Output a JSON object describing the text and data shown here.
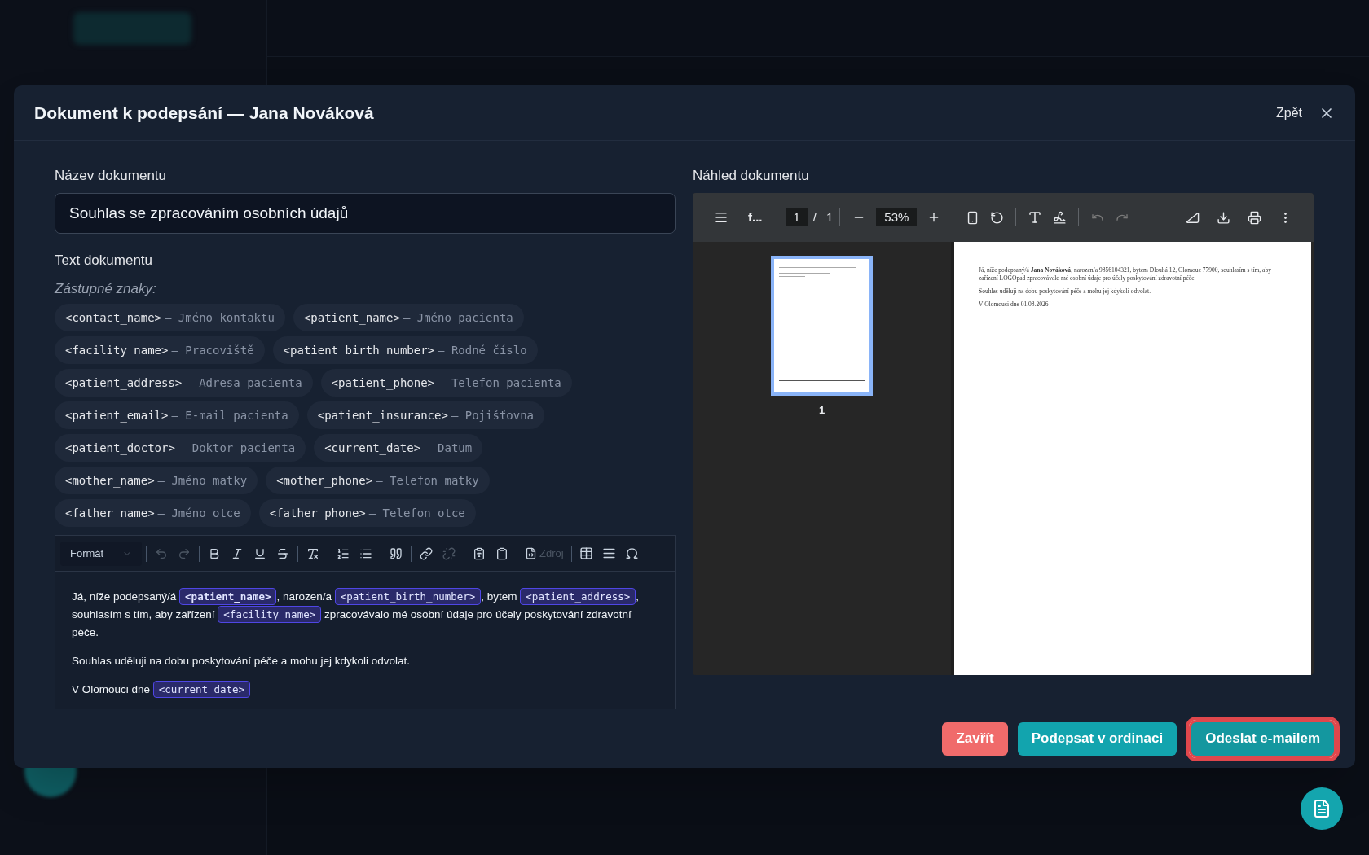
{
  "dialog": {
    "title": "Dokument k podepsání — Jana Nováková",
    "back_label": "Zpět"
  },
  "name_field": {
    "label": "Název dokumentu",
    "value": "Souhlas se zpracováním osobních údajů"
  },
  "text_section": {
    "label": "Text dokumentu",
    "placeholders_label": "Zástupné znaky:"
  },
  "placeholders": [
    {
      "code": "<contact_name>",
      "description": "— Jméno kontaktu"
    },
    {
      "code": "<patient_name>",
      "description": "— Jméno pacienta"
    },
    {
      "code": "<facility_name>",
      "description": "— Pracoviště"
    },
    {
      "code": "<patient_birth_number>",
      "description": "— Rodné číslo"
    },
    {
      "code": "<patient_address>",
      "description": "— Adresa pacienta"
    },
    {
      "code": "<patient_phone>",
      "description": "— Telefon pacienta"
    },
    {
      "code": "<patient_email>",
      "description": "— E-mail pacienta"
    },
    {
      "code": "<patient_insurance>",
      "description": "— Pojišťovna"
    },
    {
      "code": "<patient_doctor>",
      "description": "— Doktor pacienta"
    },
    {
      "code": "<current_date>",
      "description": "— Datum"
    },
    {
      "code": "<mother_name>",
      "description": "— Jméno matky"
    },
    {
      "code": "<mother_phone>",
      "description": "— Telefon matky"
    },
    {
      "code": "<father_name>",
      "description": "— Jméno otce"
    },
    {
      "code": "<father_phone>",
      "description": "— Telefon otce"
    }
  ],
  "editor": {
    "format_label": "Formát",
    "source_label": "Zdroj",
    "source_disabled": true,
    "paragraphs": [
      [
        {
          "kind": "text",
          "text": "Já, níže podepsaný/á "
        },
        {
          "kind": "tag",
          "text": "<patient_name>",
          "bold": true
        },
        {
          "kind": "text",
          "text": ", narozen/a "
        },
        {
          "kind": "tag",
          "text": "<patient_birth_number>",
          "bold": false
        },
        {
          "kind": "text",
          "text": ", bytem "
        },
        {
          "kind": "tag",
          "text": "<patient_address>",
          "bold": false
        },
        {
          "kind": "text",
          "text": ", souhlasím s tím, aby zařízení "
        },
        {
          "kind": "tag",
          "text": "<facility_name>",
          "bold": false
        },
        {
          "kind": "text",
          "text": " zpracovávalo mé osobní údaje pro účely poskytování zdravotní péče."
        }
      ],
      [
        {
          "kind": "text",
          "text": "Souhlas uděluji na dobu poskytování péče a mohu jej kdykoli odvolat."
        }
      ],
      [
        {
          "kind": "text",
          "text": "V Olomouci dne "
        },
        {
          "kind": "tag",
          "text": "<current_date>",
          "bold": false
        }
      ]
    ]
  },
  "preview": {
    "label": "Náhled dokumentu",
    "file_name": "f...",
    "page": "1",
    "page_separator": "/",
    "page_count": "1",
    "zoom": "53%",
    "thumbnail_label": "1",
    "page_paragraphs": [
      "Já, níže podepsaný/á **Jana Nováková**, narozen/a 9856104321, bytem Dlouhá 12, Olomouc 77900, souhlasím s tím, aby zařízení LOGOpad zpracovávalo mé osobní údaje pro účely poskytování zdravotní péče.",
      "Souhlas uděluji na dobu poskytování péče a mohu jej kdykoli odvolat.",
      "V Olomouci dne 01.08.2026"
    ]
  },
  "footer_buttons": [
    {
      "label": "Zavřít",
      "kind": "danger",
      "focused": false
    },
    {
      "label": "Podepsat v ordinaci",
      "kind": "secondary",
      "focused": false
    },
    {
      "label": "Odeslat e-mailem",
      "kind": "primary",
      "focused": true
    }
  ]
}
